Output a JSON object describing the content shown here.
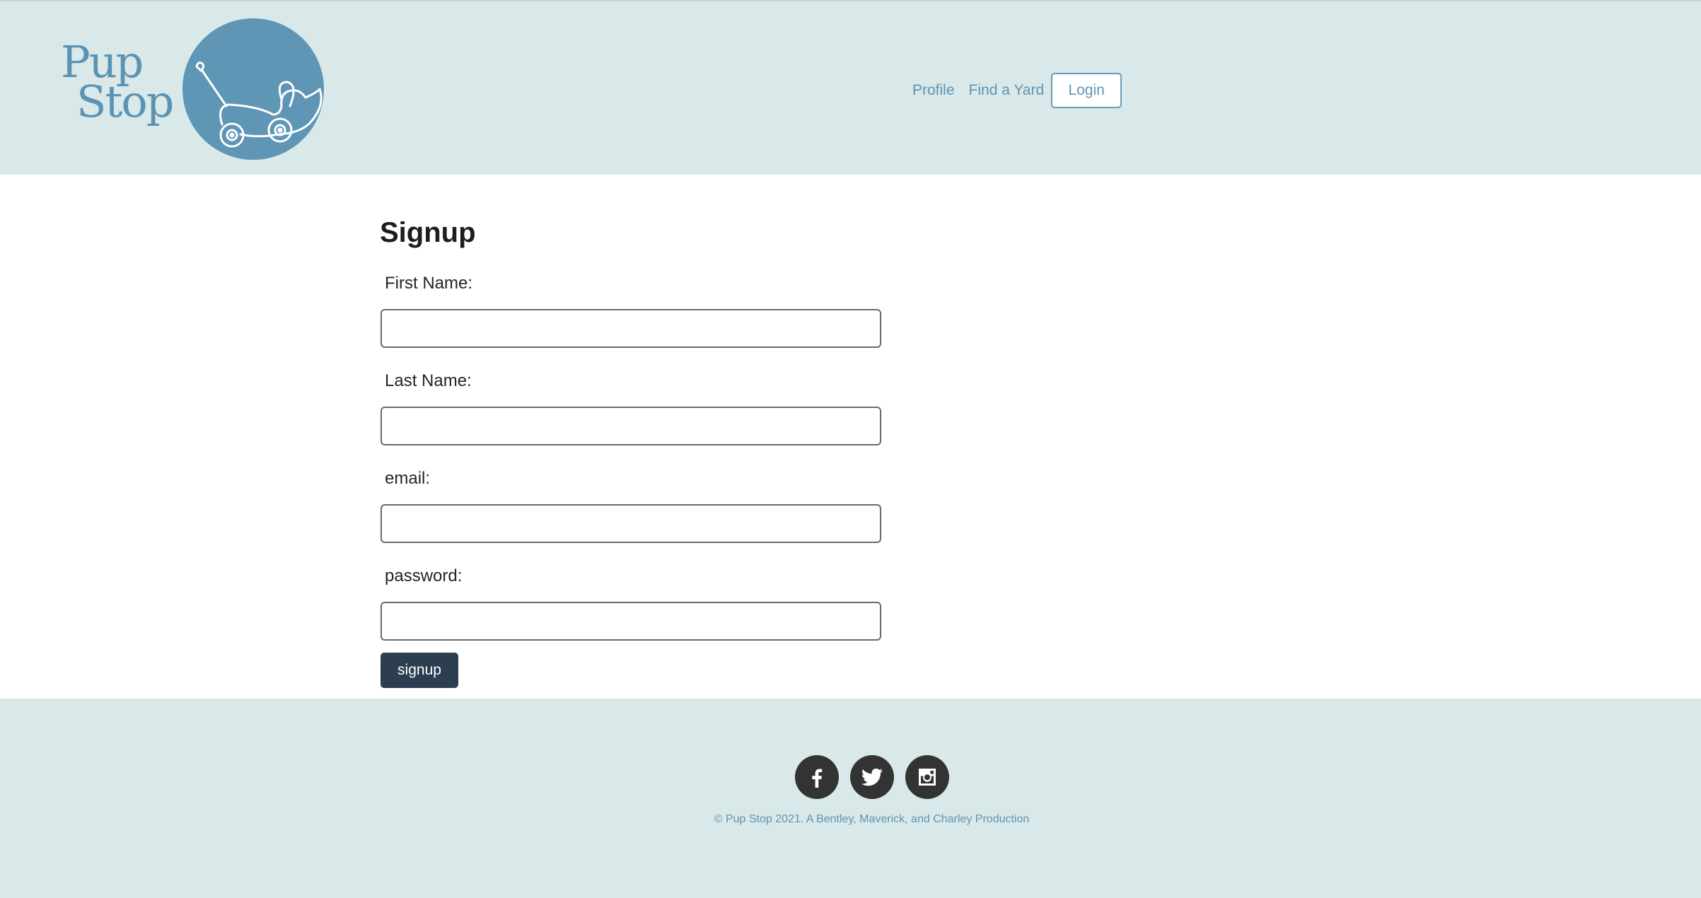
{
  "brand": {
    "logo_line1": "Pup",
    "logo_line2": "Stop",
    "logo_icon": "pull-toy-dog-icon",
    "color": "#5f96b5"
  },
  "nav": {
    "items": [
      {
        "label": "Profile"
      },
      {
        "label": "Find a Yard"
      }
    ],
    "login_label": "Login"
  },
  "form": {
    "title": "Signup",
    "fields": [
      {
        "label": "First Name:",
        "value": "",
        "placeholder": ""
      },
      {
        "label": "Last Name:",
        "value": "",
        "placeholder": ""
      },
      {
        "label": "email:",
        "value": "",
        "placeholder": ""
      },
      {
        "label": "password:",
        "value": "",
        "placeholder": ""
      }
    ],
    "submit_label": "signup"
  },
  "footer": {
    "social": [
      {
        "icon": "facebook-icon"
      },
      {
        "icon": "twitter-icon"
      },
      {
        "icon": "instagram-icon"
      }
    ],
    "copyright": "© Pup Stop 2021. A Bentley, Maverick, and Charley Production"
  },
  "colors": {
    "header_bg": "#d9e8e8",
    "accent": "#5f94b4",
    "button_dark": "#2c3e50",
    "social_bg": "#333333"
  }
}
